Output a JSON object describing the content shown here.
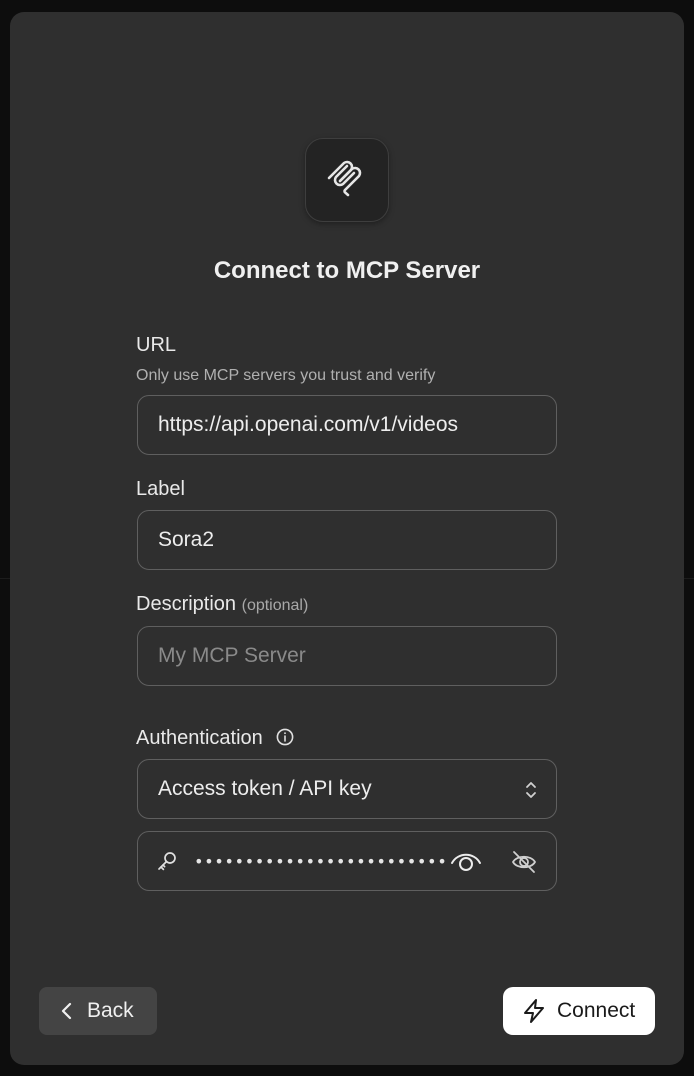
{
  "dialog": {
    "title": "Connect to MCP Server",
    "logo_icon": "mcp-logo-icon"
  },
  "url": {
    "label": "URL",
    "hint": "Only use MCP servers you trust and verify",
    "value": "https://api.openai.com/v1/videos"
  },
  "label_field": {
    "label": "Label",
    "value": "Sora2"
  },
  "description": {
    "label": "Description",
    "optional": "(optional)",
    "placeholder": "My MCP Server"
  },
  "authentication": {
    "label": "Authentication",
    "info_icon": "info-icon",
    "selected": "Access token / API key",
    "token_masked": "••••••••••••••••••••••••••••••••••••••••••",
    "key_icon": "key-icon",
    "reveal_icon": "eye-icon",
    "hide_icon": "eye-off-icon"
  },
  "footer": {
    "back_label": "Back",
    "connect_label": "Connect"
  },
  "colors": {
    "modal_bg": "#2f2f2f",
    "page_bg": "#0d0d0d",
    "primary_button": "#ffffff",
    "secondary_button": "#444444",
    "field_border": "#5f5f5f"
  }
}
